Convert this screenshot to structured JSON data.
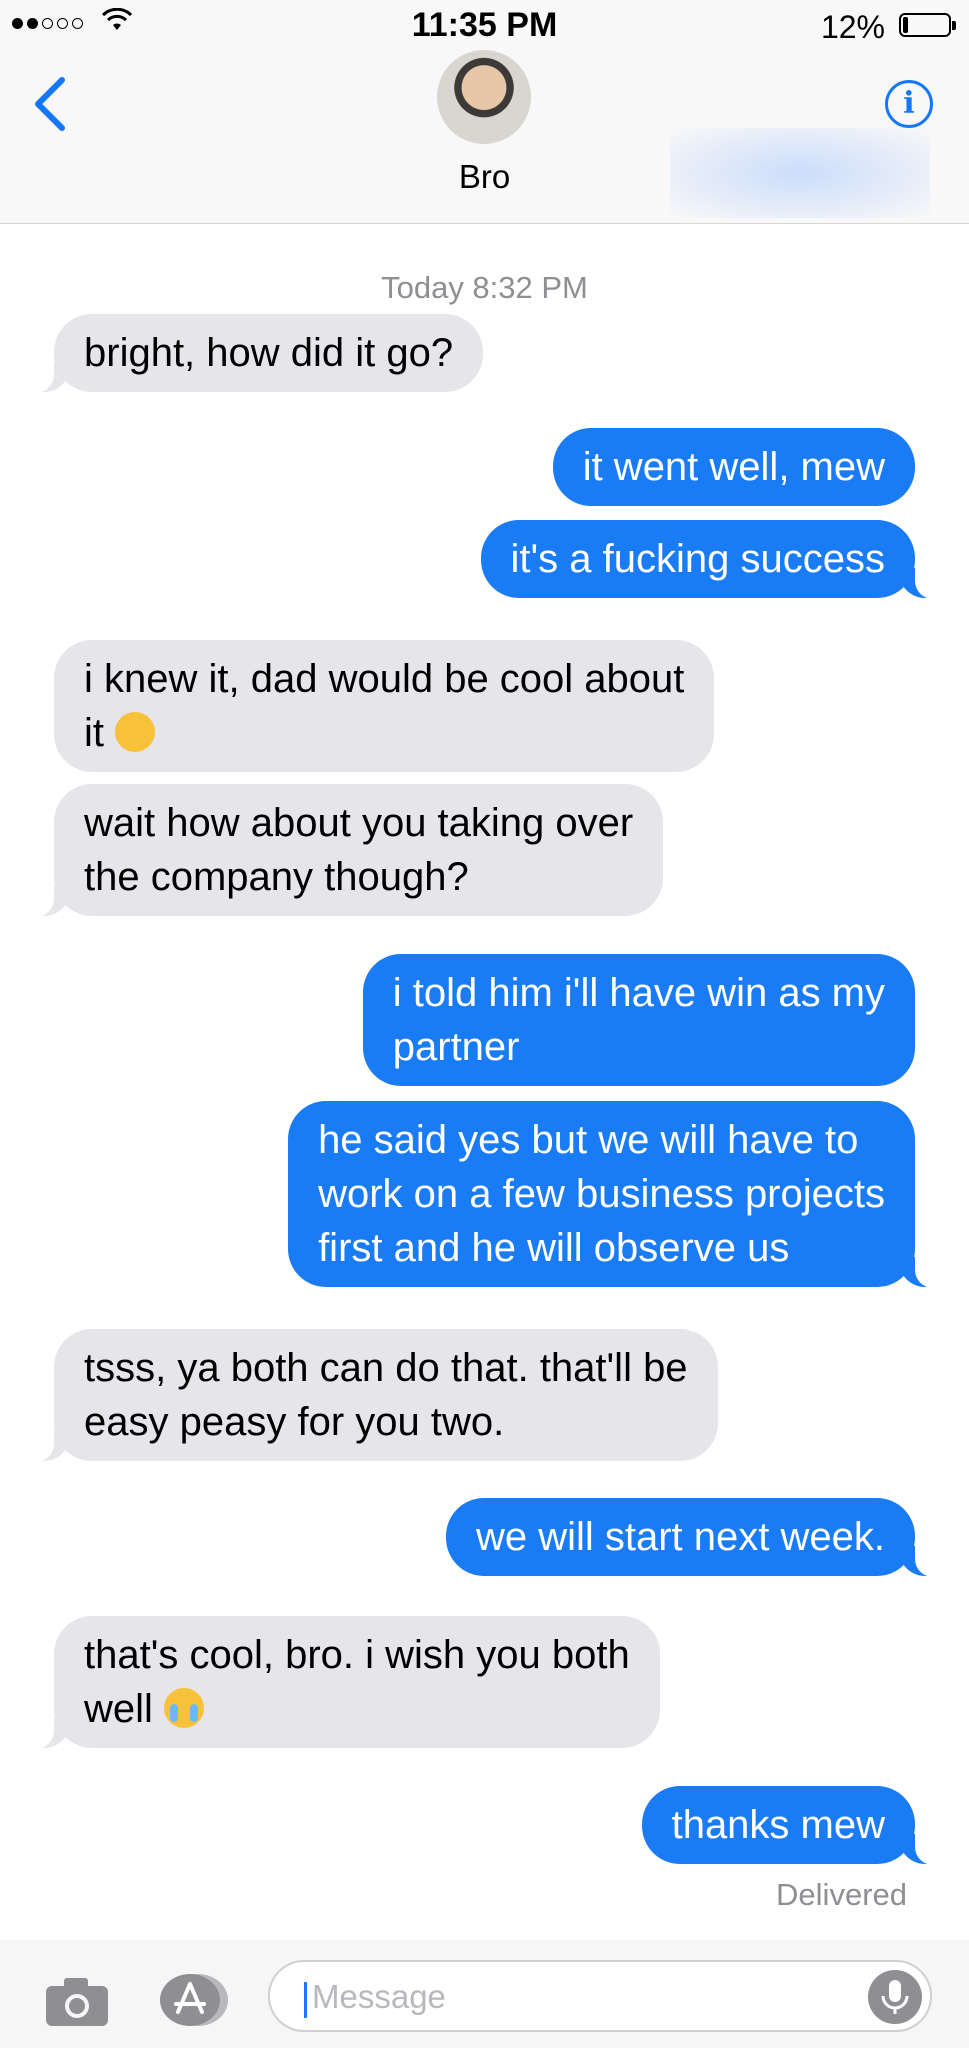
{
  "status_bar": {
    "time": "11:35 PM",
    "battery": "12%",
    "battery_level": 0.12
  },
  "header": {
    "contact_name": "Bro",
    "back_icon": "chevron-left-icon",
    "info_icon": "info-icon"
  },
  "conversation": {
    "timestamp": "Today 8:32 PM",
    "messages": [
      {
        "from": "them",
        "text": "bright, how did it go?"
      },
      {
        "from": "me",
        "text": "it went well, mew"
      },
      {
        "from": "me",
        "text": "it's a fucking success"
      },
      {
        "from": "them",
        "line1": "i knew it, dad would be cool about",
        "line2": "it",
        "emoji": "relieved-face-emoji"
      },
      {
        "from": "them",
        "line1": "wait how about you taking over",
        "line2": "the company though?"
      },
      {
        "from": "me",
        "line1": "i told him i'll have win as my",
        "line2": "partner"
      },
      {
        "from": "me",
        "line1": "he said yes but we will have to",
        "line2": "work on a few business projects",
        "line3": "first and he will observe us"
      },
      {
        "from": "them",
        "line1": "tsss, ya both can do that. that'll be",
        "line2": "easy peasy for you two."
      },
      {
        "from": "me",
        "text": "we will start next week."
      },
      {
        "from": "them",
        "line1": "that's cool, bro. i wish you both",
        "line2": "well",
        "emoji": "crying-face-emoji"
      },
      {
        "from": "me",
        "text": "thanks mew"
      }
    ],
    "receipt": "Delivered"
  },
  "input_bar": {
    "placeholder": "Message",
    "camera_icon": "camera-icon",
    "apps_icon": "app-store-icon",
    "mic_icon": "microphone-icon"
  },
  "colors": {
    "accent": "#1a7cf5",
    "incoming_bubble": "#e5e5ea",
    "meta_text": "#8e8e93"
  }
}
